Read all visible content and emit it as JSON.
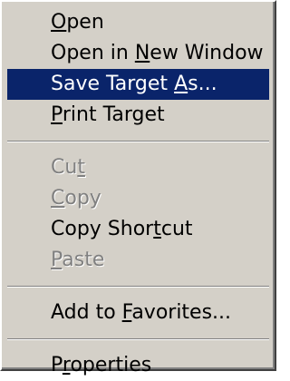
{
  "menu": {
    "items": [
      {
        "pre": "",
        "acc": "O",
        "post": "pen",
        "state": "normal"
      },
      {
        "pre": "Open in ",
        "acc": "N",
        "post": "ew Window",
        "state": "normal"
      },
      {
        "pre": "Save Target ",
        "acc": "A",
        "post": "s...",
        "state": "highlight"
      },
      {
        "pre": "",
        "acc": "P",
        "post": "rint Target",
        "state": "normal"
      },
      {
        "pre": "Cu",
        "acc": "t",
        "post": "",
        "state": "disabled"
      },
      {
        "pre": "",
        "acc": "C",
        "post": "opy",
        "state": "disabled"
      },
      {
        "pre": "Copy Shor",
        "acc": "t",
        "post": "cut",
        "state": "normal"
      },
      {
        "pre": "",
        "acc": "P",
        "post": "aste",
        "state": "disabled"
      },
      {
        "pre": "Add to ",
        "acc": "F",
        "post": "avorites...",
        "state": "normal"
      },
      {
        "pre": "P",
        "acc": "r",
        "post": "operties",
        "state": "normal"
      }
    ]
  },
  "colors": {
    "menu_bg": "#d4d0c8",
    "highlight_bg": "#0a246a",
    "highlight_text": "#ffffff",
    "disabled_text": "#808080"
  }
}
